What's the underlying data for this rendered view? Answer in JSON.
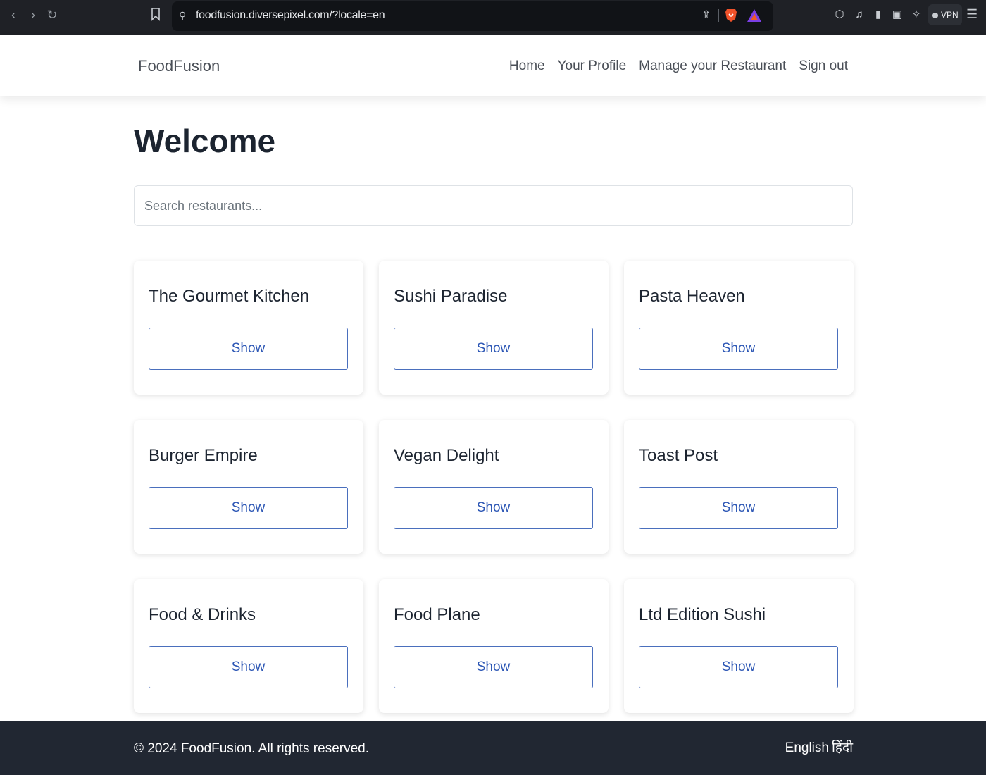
{
  "browser": {
    "url": "foodfusion.diversepixel.com/?locale=en",
    "vpn_label": "VPN"
  },
  "navbar": {
    "brand": "FoodFusion",
    "links": [
      "Home",
      "Your Profile",
      "Manage your Restaurant",
      "Sign out"
    ]
  },
  "main": {
    "title": "Welcome",
    "search_placeholder": "Search restaurants...",
    "restaurants": [
      {
        "name": "The Gourmet Kitchen",
        "button": "Show"
      },
      {
        "name": "Sushi Paradise",
        "button": "Show"
      },
      {
        "name": "Pasta Heaven",
        "button": "Show"
      },
      {
        "name": "Burger Empire",
        "button": "Show"
      },
      {
        "name": "Vegan Delight",
        "button": "Show"
      },
      {
        "name": "Toast Post",
        "button": "Show"
      },
      {
        "name": "Food & Drinks",
        "button": "Show"
      },
      {
        "name": "Food Plane",
        "button": "Show"
      },
      {
        "name": "Ltd Edition Sushi",
        "button": "Show"
      }
    ]
  },
  "footer": {
    "copyright": "© 2024 FoodFusion. All rights reserved.",
    "languages": [
      "English",
      "हिंदी"
    ]
  },
  "colors": {
    "browser_bg": "#1f2126",
    "button_border": "#4a6fbd",
    "button_text": "#2d57b5",
    "footer_bg": "#212732"
  }
}
